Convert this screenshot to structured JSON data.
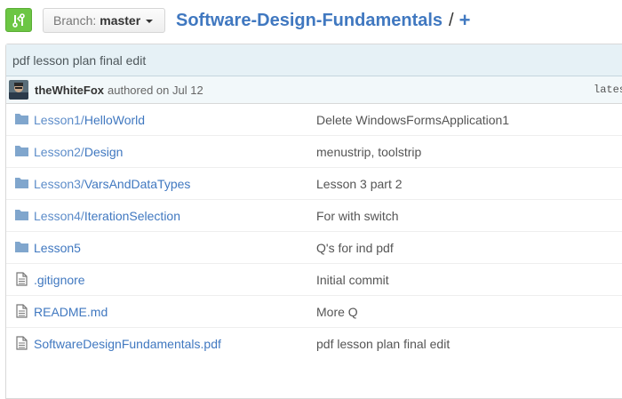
{
  "header": {
    "compare_icon": "compare-arrows-icon",
    "branch_label": "Branch:",
    "branch_value": "master",
    "repo_name": "Software-Design-Fundamentals",
    "separator": "/",
    "add_label": "+"
  },
  "commit": {
    "title": "pdf lesson plan final edit",
    "author": "theWhiteFox",
    "authored": "authored on Jul 12",
    "latest": "lates"
  },
  "files": [
    {
      "type": "folder",
      "prefix": "Lesson1/",
      "name": "HelloWorld",
      "message": "Delete WindowsFormsApplication1"
    },
    {
      "type": "folder",
      "prefix": "Lesson2/",
      "name": "Design",
      "message": "menustrip, toolstrip"
    },
    {
      "type": "folder",
      "prefix": "Lesson3/",
      "name": "VarsAndDataTypes",
      "message": "Lesson 3 part 2"
    },
    {
      "type": "folder",
      "prefix": "Lesson4/",
      "name": "IterationSelection",
      "message": "For with switch"
    },
    {
      "type": "folder",
      "prefix": "",
      "name": "Lesson5",
      "message": "Q's for ind pdf"
    },
    {
      "type": "file",
      "prefix": "",
      "name": ".gitignore",
      "message": "Initial commit"
    },
    {
      "type": "file",
      "prefix": "",
      "name": "README.md",
      "message": "More Q"
    },
    {
      "type": "file",
      "prefix": "",
      "name": "SoftwareDesignFundamentals.pdf",
      "message": "pdf lesson plan final edit"
    }
  ],
  "colors": {
    "link": "#4078c0",
    "compare_green": "#6cc644",
    "commit_bg": "#e6f1f6",
    "meta_bg": "#f2f8fa",
    "folder": "#80a6cd",
    "file": "#777777"
  }
}
